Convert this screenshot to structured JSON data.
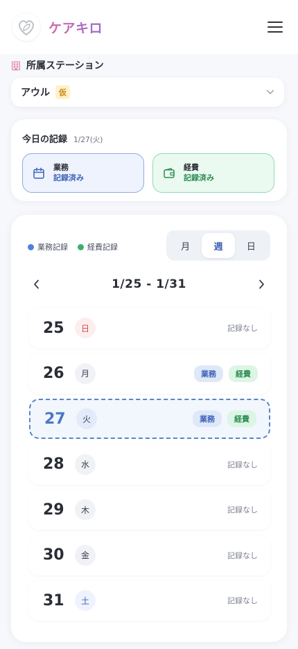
{
  "app": {
    "name": "ケアキロ"
  },
  "station": {
    "label": "所属ステーション",
    "name": "アウル",
    "badge": "仮"
  },
  "today": {
    "title": "今日の記録",
    "date": "1/27(火)",
    "work": {
      "title": "業務",
      "status": "記録済み"
    },
    "expense": {
      "title": "経費",
      "status": "記録済み"
    }
  },
  "calendar": {
    "legend": {
      "work": "業務記録",
      "expense": "経費記録"
    },
    "colors": {
      "work": "#4f7fe0",
      "expense": "#3fae69"
    },
    "views": [
      "月",
      "週",
      "日"
    ],
    "active_view": "週",
    "range": "1/25 - 1/31",
    "no_record_text": "記録なし",
    "days": [
      {
        "num": "25",
        "wd": "日",
        "work": null,
        "expense": null
      },
      {
        "num": "26",
        "wd": "月",
        "work": "業務",
        "expense": "経費"
      },
      {
        "num": "27",
        "wd": "火",
        "work": "業務",
        "expense": "経費"
      },
      {
        "num": "28",
        "wd": "水",
        "work": null,
        "expense": null
      },
      {
        "num": "29",
        "wd": "木",
        "work": null,
        "expense": null
      },
      {
        "num": "30",
        "wd": "金",
        "work": null,
        "expense": null
      },
      {
        "num": "31",
        "wd": "土",
        "work": null,
        "expense": null
      }
    ]
  }
}
